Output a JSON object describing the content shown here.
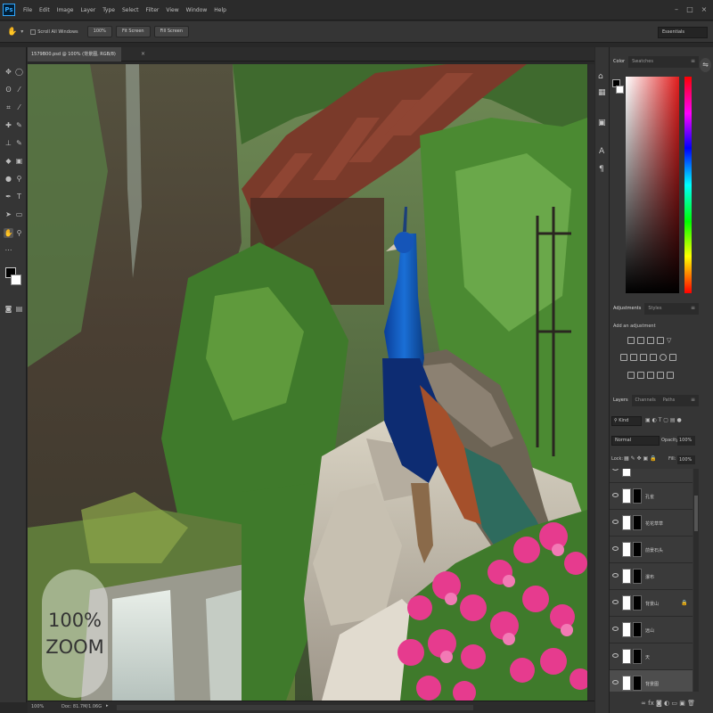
{
  "app": {
    "logo": "Ps"
  },
  "menubar": {
    "items": [
      "File",
      "Edit",
      "Image",
      "Layer",
      "Type",
      "Select",
      "Filter",
      "View",
      "Window",
      "Help"
    ],
    "win_min": "–",
    "win_max": "□",
    "win_close": "×"
  },
  "options": {
    "tool_icon": "hand-icon",
    "scroll_all_windows": "Scroll All Windows",
    "zoom_100": "100%",
    "fit_screen": "Fit Screen",
    "fill_screen": "Fill Screen",
    "workspace": "Essentials"
  },
  "document": {
    "tab_title": "1579B00.psd @ 100% (背景图, RGB/8)",
    "close": "×"
  },
  "status": {
    "zoom": "100%",
    "doc_info": "Doc: 81.7M/1.06G"
  },
  "panels": {
    "color": {
      "tabs": [
        "Color",
        "Swatches"
      ]
    },
    "adjustments": {
      "tabs": [
        "Adjustments",
        "Styles"
      ],
      "add_label": "Add an adjustment"
    },
    "layers": {
      "tabs": [
        "Layers",
        "Channels",
        "Paths"
      ],
      "kind": "Kind",
      "blend_mode": "Normal",
      "opacity_label": "Opacity:",
      "opacity_value": "100%",
      "lock_label": "Lock:",
      "fill_label": "Fill:",
      "fill_value": "100%",
      "items": [
        {
          "name": "孔雀"
        },
        {
          "name": "花花草草"
        },
        {
          "name": "前景石头"
        },
        {
          "name": "瀑布"
        },
        {
          "name": "背景山"
        },
        {
          "name": "远山"
        },
        {
          "name": "天"
        },
        {
          "name": "背景图"
        }
      ]
    }
  },
  "overlay": {
    "zoom_line1": "100%",
    "zoom_line2": "ZOOM"
  }
}
